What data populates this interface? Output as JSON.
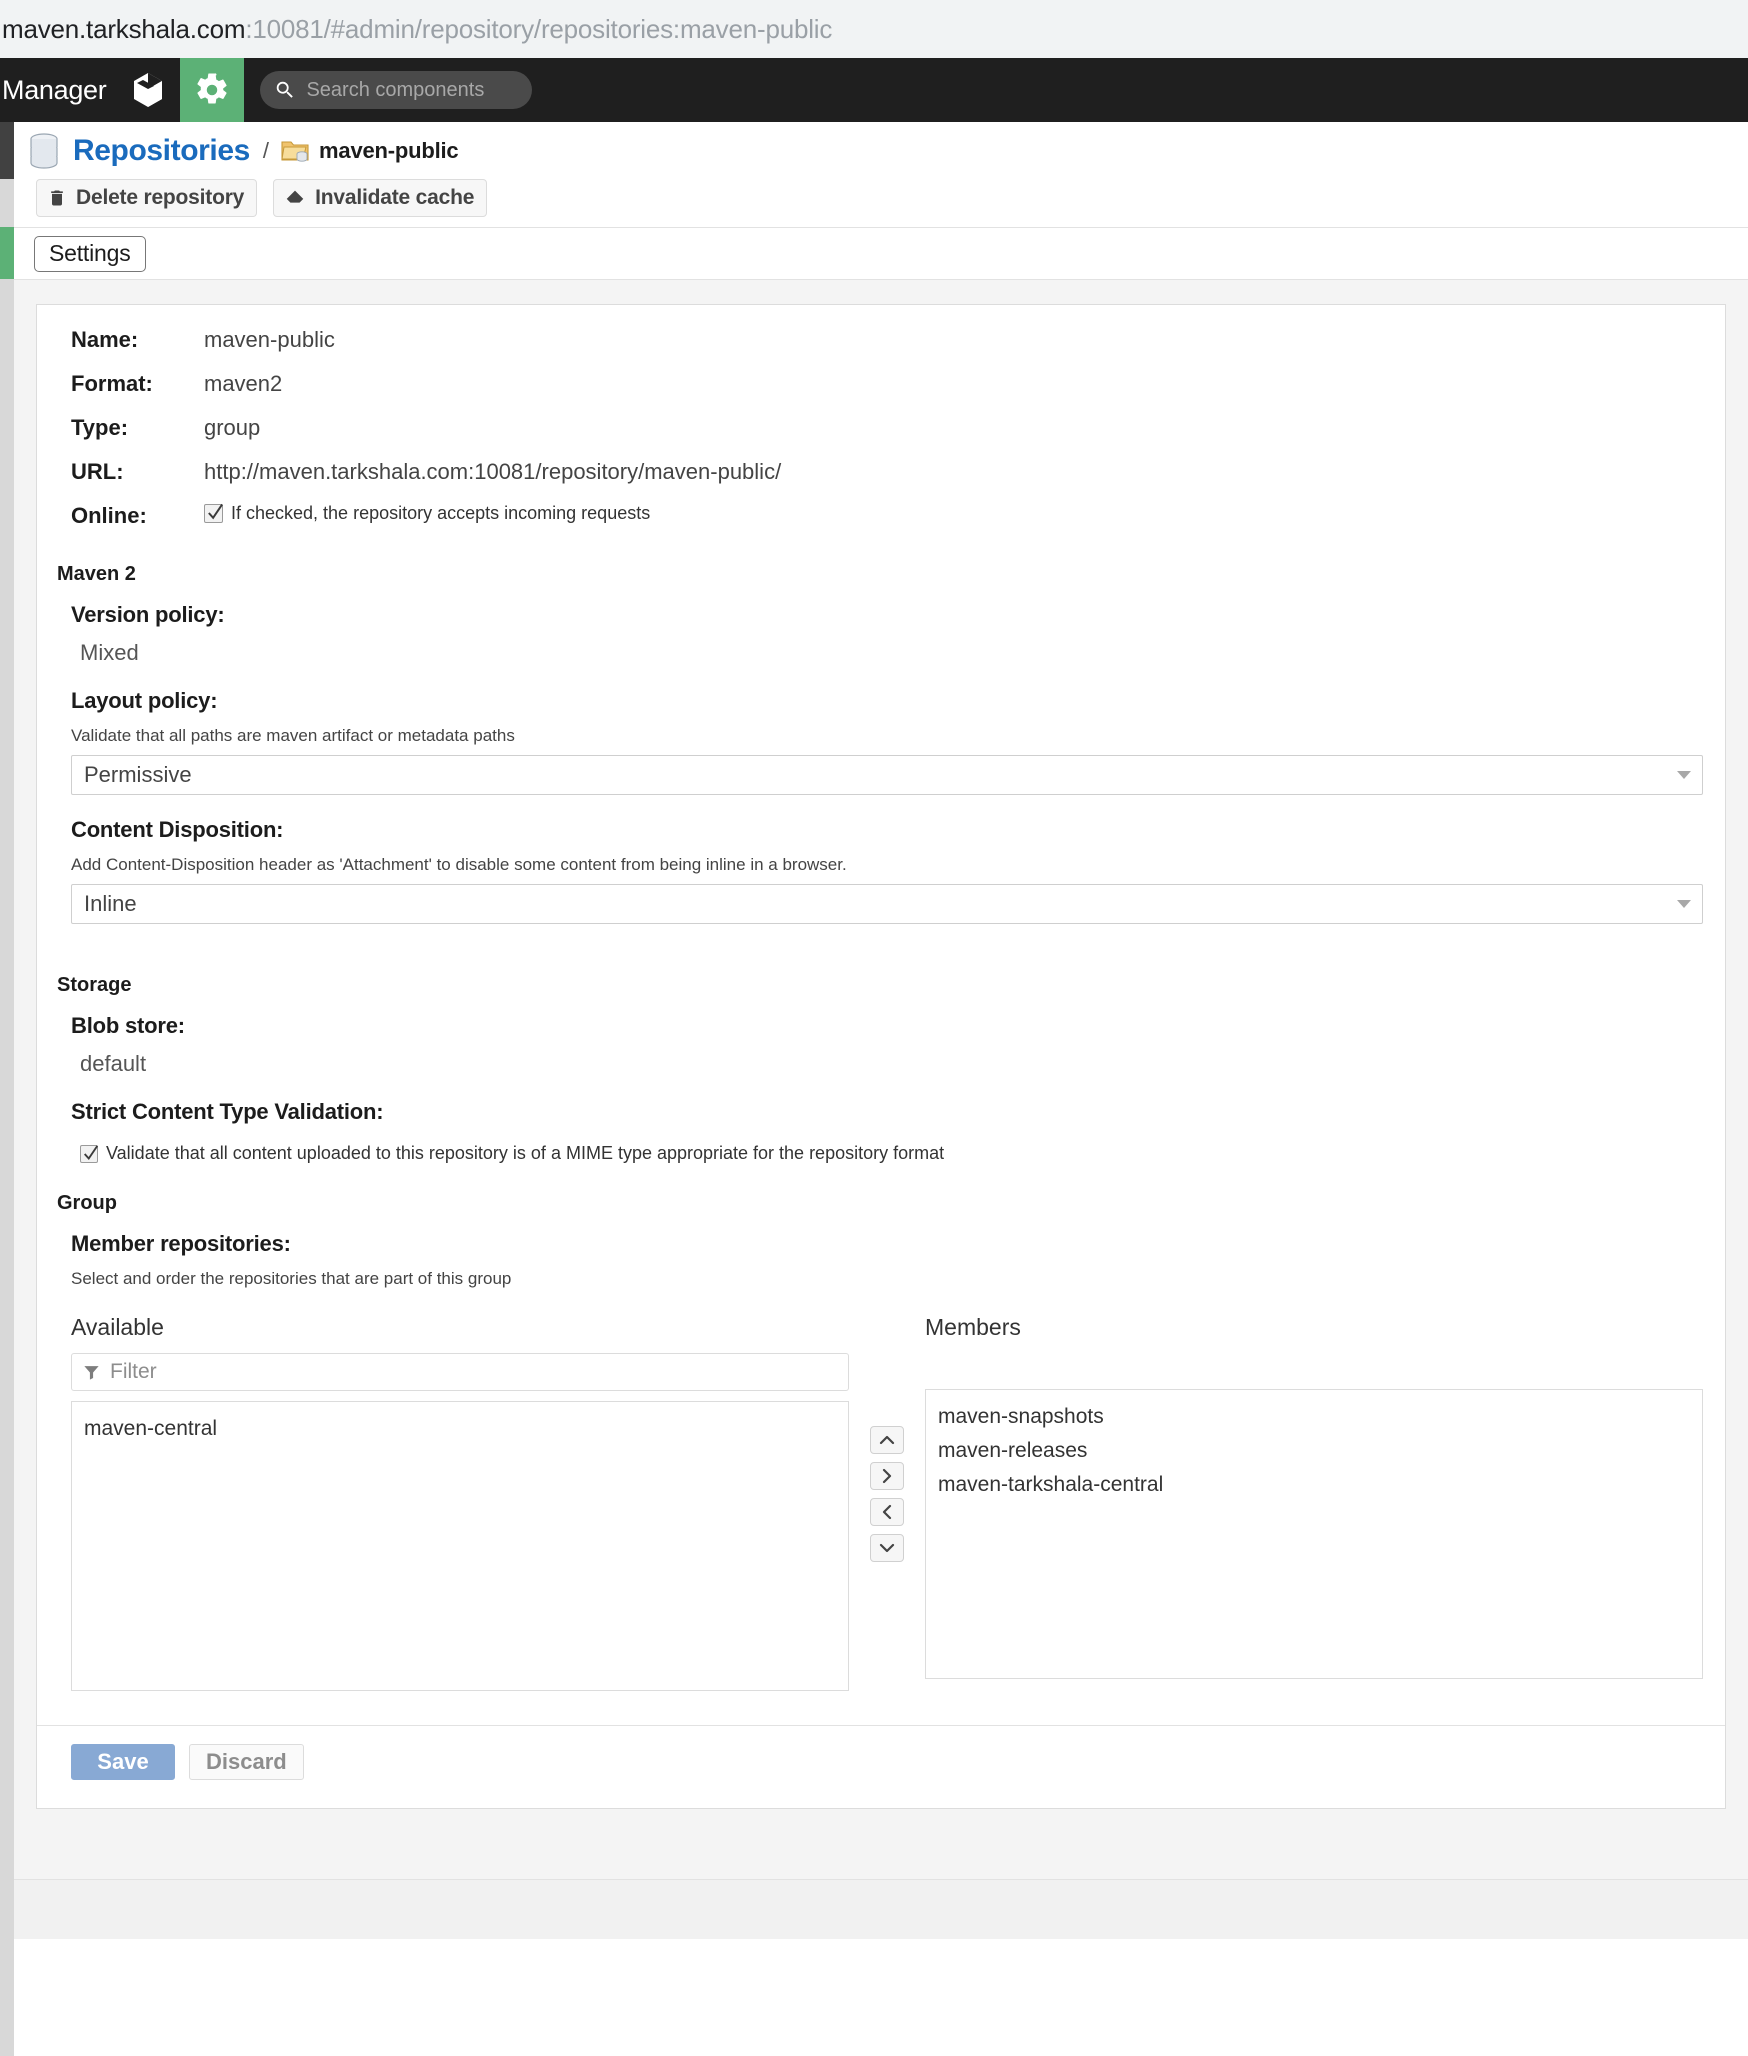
{
  "browser": {
    "url_host": "maven.tarkshala.com",
    "url_path": ":10081/#admin/repository/repositories:maven-public"
  },
  "appbar": {
    "title": "Manager",
    "icons": [
      {
        "name": "cube-icon",
        "active": false
      },
      {
        "name": "gear-icon",
        "active": true
      }
    ],
    "search_placeholder": "Search components",
    "accent_color": "#5cb176"
  },
  "breadcrumb": {
    "root": "Repositories",
    "separator": "/",
    "leaf": "maven-public"
  },
  "toolbar": {
    "delete_label": "Delete repository",
    "invalidate_label": "Invalidate cache"
  },
  "tabs": [
    {
      "label": "Settings",
      "selected": true
    }
  ],
  "summary": {
    "rows": [
      {
        "key": "Name:",
        "value": "maven-public"
      },
      {
        "key": "Format:",
        "value": "maven2"
      },
      {
        "key": "Type:",
        "value": "group"
      },
      {
        "key": "URL:",
        "value": "http://maven.tarkshala.com:10081/repository/maven-public/"
      }
    ],
    "online": {
      "key": "Online:",
      "checked": true,
      "text": "If checked, the repository accepts incoming requests"
    }
  },
  "maven2": {
    "section_title": "Maven 2",
    "version_policy": {
      "label": "Version policy:",
      "value": "Mixed"
    },
    "layout_policy": {
      "label": "Layout policy:",
      "help": "Validate that all paths are maven artifact or metadata paths",
      "value": "Permissive"
    },
    "content_disposition": {
      "label": "Content Disposition:",
      "help": "Add Content-Disposition header as 'Attachment' to disable some content from being inline in a browser.",
      "value": "Inline"
    }
  },
  "storage": {
    "section_title": "Storage",
    "blob_store": {
      "label": "Blob store:",
      "value": "default"
    },
    "strict_validation": {
      "label": "Strict Content Type Validation:",
      "checked": true,
      "text": "Validate that all content uploaded to this repository is of a MIME type appropriate for the repository format"
    }
  },
  "group": {
    "section_title": "Group",
    "member_repositories": {
      "label": "Member repositories:",
      "help": "Select and order the repositories that are part of this group",
      "available_header": "Available",
      "members_header": "Members",
      "filter_placeholder": "Filter",
      "available": [
        "maven-central"
      ],
      "members": [
        "maven-snapshots",
        "maven-releases",
        "maven-tarkshala-central"
      ],
      "transfer_buttons": [
        {
          "name": "move-up-button",
          "glyph": "⌃"
        },
        {
          "name": "move-right-button",
          "glyph": "›"
        },
        {
          "name": "move-left-button",
          "glyph": "‹"
        },
        {
          "name": "move-down-button",
          "glyph": "⌄"
        }
      ]
    }
  },
  "footer": {
    "save_label": "Save",
    "discard_label": "Discard",
    "save_color": "#88a9d4"
  }
}
